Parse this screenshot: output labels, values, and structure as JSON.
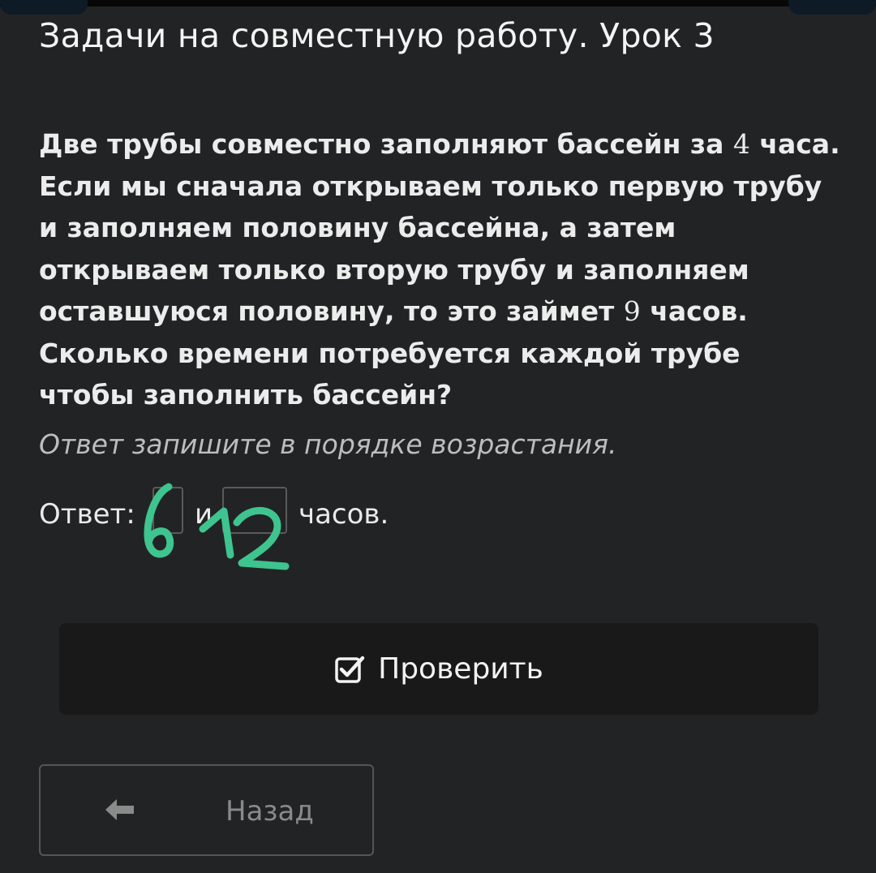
{
  "page": {
    "title": "Задачи на совместную работу. Урок 3"
  },
  "question": {
    "part1": "Две трубы совместно заполняют бассейн за ",
    "num1": "4",
    "part2": " часа. Если мы сначала открываем только первую трубу и заполняем половину бассейна, а затем открываем только вторую трубу и заполняем оставшуюся половину, то это займет ",
    "num2": "9",
    "part3": " часов. Сколько времени потребуется каждой трубе чтобы заполнить бассейн?"
  },
  "hint": "Ответ запишите в порядке возрастания.",
  "answer": {
    "label": "Ответ:",
    "input1_value": "",
    "conjunction": "и",
    "input2_value": "",
    "units": "часов.",
    "handwritten_1": "6",
    "handwritten_2": "12",
    "handwriting_color": "#3ec48f"
  },
  "buttons": {
    "check_label": "Проверить",
    "check_icon": "checkbox-check-icon",
    "back_label": "Назад",
    "back_icon": "arrow-left-icon"
  },
  "colors": {
    "background": "#222324",
    "button_bg": "#191919"
  }
}
